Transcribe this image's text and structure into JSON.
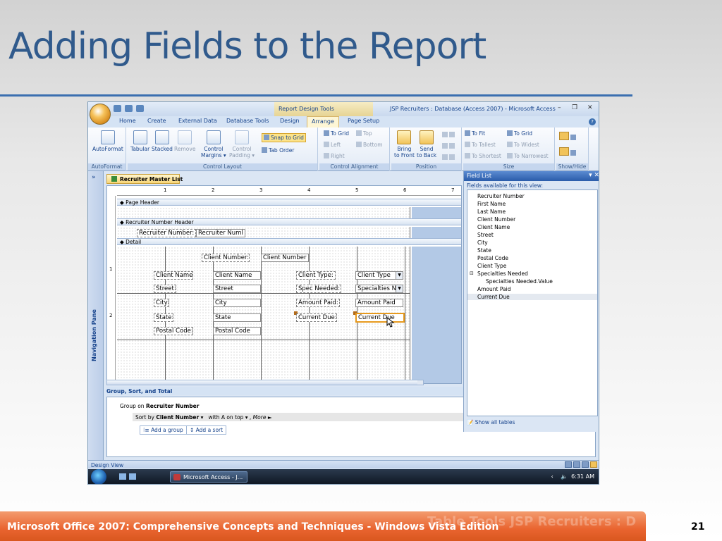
{
  "slide": {
    "title": "Adding Fields to the Report",
    "footer": "Microsoft Office 2007: Comprehensive Concepts and Techniques - Windows Vista Edition",
    "footer_ghost": "Table Tools     JSP Recruiters : D",
    "number": "21"
  },
  "window": {
    "context_tab": "Report Design Tools",
    "title": "JSP Recruiters : Database (Access 2007) - Microsoft Access",
    "tabs": [
      "Home",
      "Create",
      "External Data",
      "Database Tools",
      "Design",
      "Arrange",
      "Page Setup"
    ],
    "active_tab": "Arrange"
  },
  "ribbon": {
    "autoformat": {
      "button": "AutoFormat",
      "group": "AutoFormat"
    },
    "control_layout": {
      "tabular": "Tabular",
      "stacked": "Stacked",
      "remove": "Remove",
      "control_margins_1": "Control",
      "control_margins_2": "Margins ▾",
      "control_padding_1": "Control",
      "control_padding_2": "Padding ▾",
      "snap": "Snap to Grid",
      "tab_order": "Tab Order",
      "group": "Control Layout"
    },
    "alignment": {
      "to_grid": "To Grid",
      "left": "Left",
      "right": "Right",
      "top": "Top",
      "bottom": "Bottom",
      "group": "Control Alignment"
    },
    "position": {
      "bring_1": "Bring",
      "bring_2": "to Front",
      "send_1": "Send",
      "send_2": "to Back",
      "group": "Position"
    },
    "size": {
      "to_fit": "To Fit",
      "to_grid": "To Grid",
      "to_tallest": "To Tallest",
      "to_widest": "To Widest",
      "to_shortest": "To Shortest",
      "to_narrowest": "To Narrowest",
      "group": "Size"
    },
    "showhide": {
      "group": "Show/Hide"
    }
  },
  "nav_pane": {
    "label": "Navigation Pane",
    "chevron": "»"
  },
  "document_tab": "Recruiter Master List",
  "ruler": {
    "marks": [
      "1",
      "2",
      "3",
      "4",
      "5",
      "6",
      "7"
    ],
    "left_marks": [
      "1",
      "2"
    ]
  },
  "bands": {
    "page_header": "Page Header",
    "group_header": "Recruiter Number Header",
    "detail": "Detail"
  },
  "controls": {
    "recruiter_number_label": "Recruiter Number:",
    "recruiter_number_text": "Recruiter Numl",
    "client_number_label": "Client Number:",
    "client_number_text": "Client Number",
    "client_name_label": "Client Name:",
    "client_name_text": "Client Name",
    "client_type_label": "Client Type:",
    "client_type_text": "Client Type",
    "street_label": "Street:",
    "street_text": "Street",
    "spec_label": "Spec Needed:",
    "spec_text": "Specialties N",
    "city_label": "City:",
    "city_text": "City",
    "amount_label": "Amount Paid:",
    "amount_text": "Amount Paid",
    "state_label": "State:",
    "state_text": "State",
    "current_due_label": "Current Due:",
    "current_due_text": "Current Due",
    "postal_label": "Postal Code:",
    "postal_text": "Postal Code"
  },
  "group_sort": {
    "header": "Group, Sort, and Total",
    "group_on": "Group on",
    "group_field": "Recruiter Number",
    "sort_by": "Sort by",
    "sort_field": "Client Number",
    "order": "with A on top",
    "more": "More ►",
    "add_group": "Add a group",
    "add_sort": "Add a sort"
  },
  "field_list": {
    "title": "Field List",
    "subtitle": "Fields available for this view:",
    "items": [
      "Recruiter Number",
      "First Name",
      "Last Name",
      "Client Number",
      "Client Name",
      "Street",
      "City",
      "State",
      "Postal Code",
      "Client Type",
      "Specialties Needed"
    ],
    "child": "Specialties Needed.Value",
    "tail": [
      "Amount Paid",
      "Current Due"
    ],
    "selected": "Current Due",
    "show_all": "Show all tables"
  },
  "status": {
    "view": "Design View"
  },
  "taskbar": {
    "app": "Microsoft Access - J...",
    "time": "6:31 AM"
  },
  "colors": {
    "title": "#305a8c",
    "footer": "#e9642f",
    "selection": "#e69a1f"
  }
}
